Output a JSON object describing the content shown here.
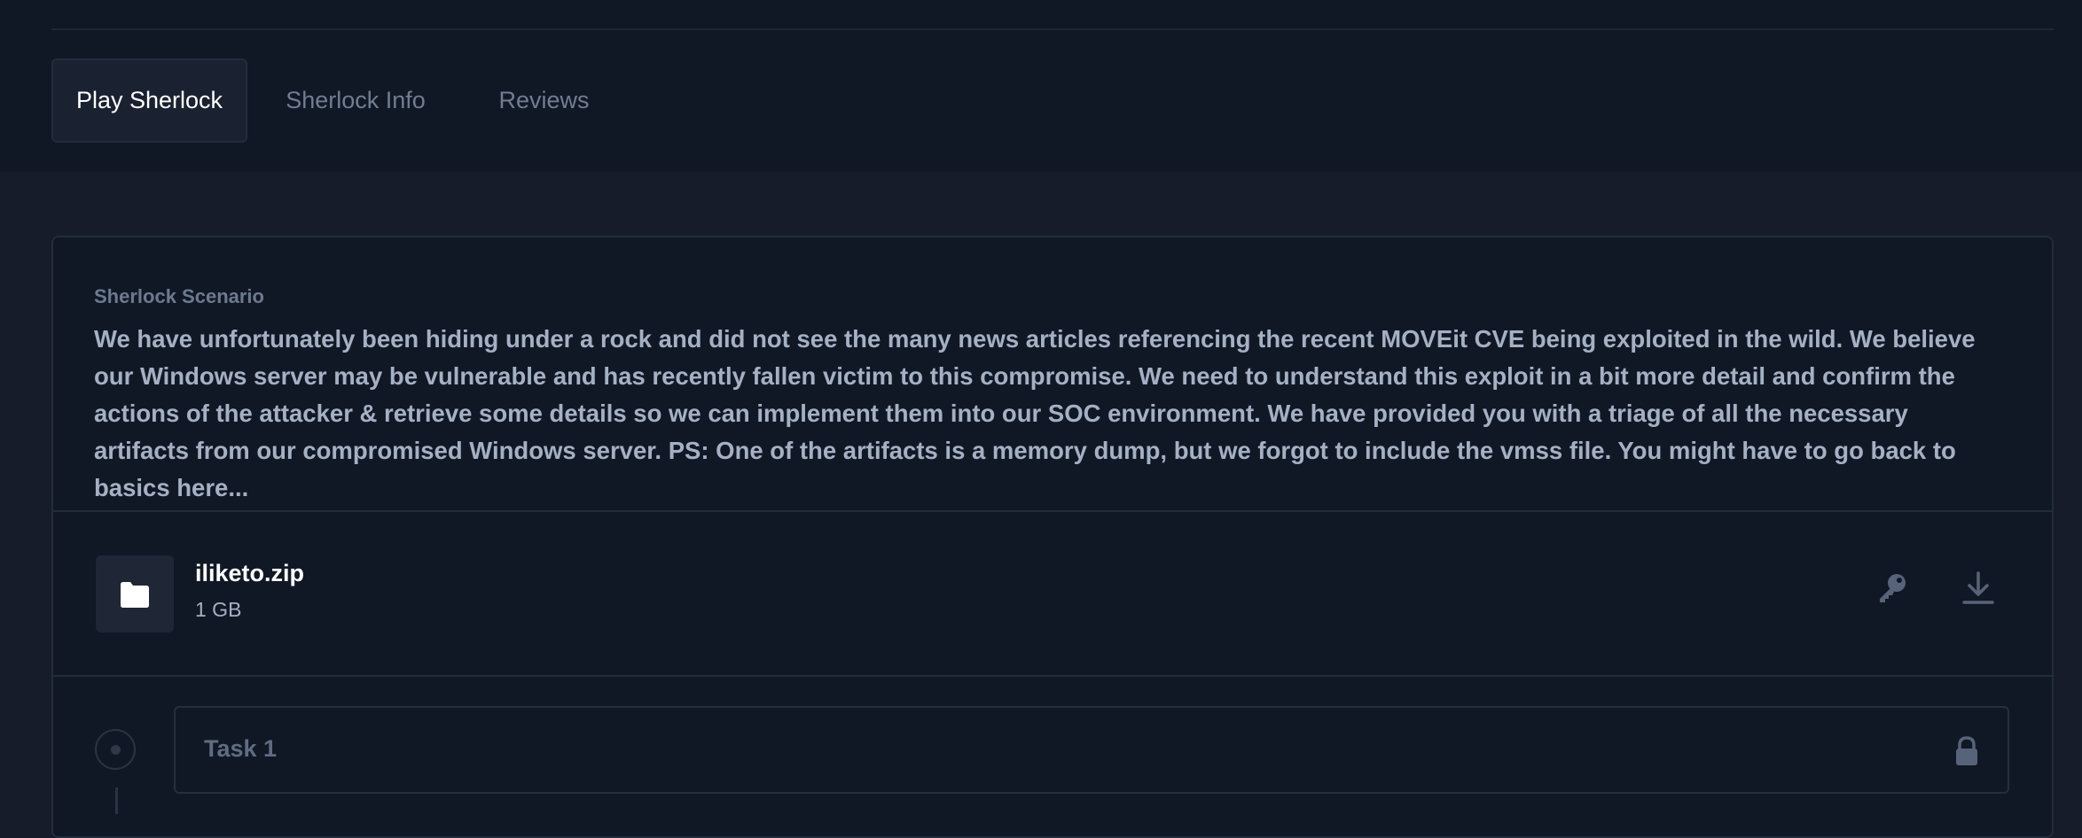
{
  "tabs": [
    {
      "label": "Play Sherlock",
      "active": true
    },
    {
      "label": "Sherlock Info",
      "active": false
    },
    {
      "label": "Reviews",
      "active": false
    }
  ],
  "scenario": {
    "label": "Sherlock Scenario",
    "text": "We have unfortunately been hiding under a rock and did not see the many news articles referencing the recent MOVEit CVE being exploited in the wild. We believe our Windows server may be vulnerable and has recently fallen victim to this compromise. We need to understand this exploit in a bit more detail and confirm the actions of the attacker & retrieve some details so we can implement them into our SOC environment. We have provided you with a triage of all the necessary artifacts from our compromised Windows server. PS: One of the artifacts is a memory dump, but we forgot to include the vmss file. You might have to go back to basics here..."
  },
  "file": {
    "name": "iliketo.zip",
    "size": "1 GB",
    "icon": "folder-icon",
    "actions": [
      "key-icon",
      "download-icon"
    ]
  },
  "task": {
    "label": "Task 1",
    "status_icon": "lock-icon"
  },
  "colors": {
    "background": "#111825",
    "panel": "#161c29",
    "border": "#232c3c",
    "text_muted": "#707d92",
    "text_body": "#a4b0c3"
  }
}
